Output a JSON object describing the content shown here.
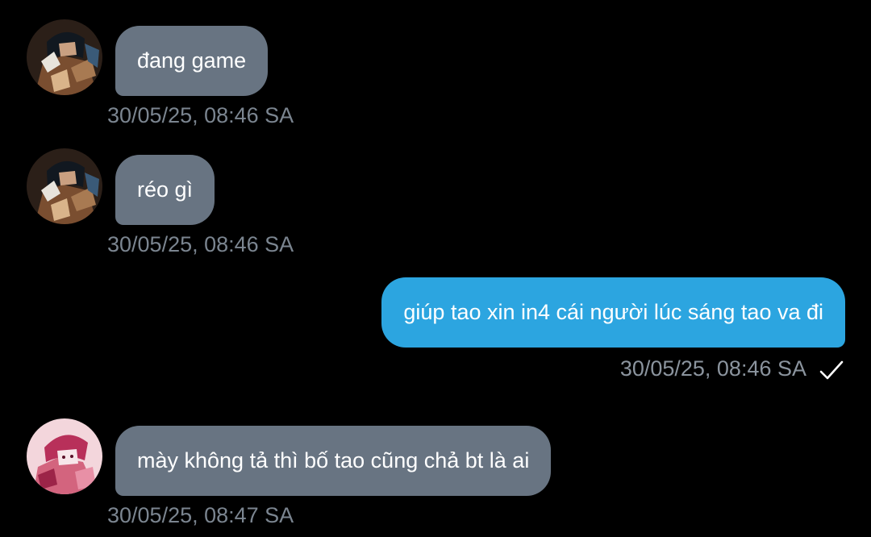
{
  "messages": [
    {
      "direction": "in",
      "avatar": "avatar-anime-dark",
      "text": "đang game",
      "time": "30/05/25, 08:46 SA"
    },
    {
      "direction": "in",
      "avatar": "avatar-anime-dark",
      "text": "réo gì",
      "time": "30/05/25, 08:46 SA"
    },
    {
      "direction": "out",
      "text": "giúp tao xin in4 cái người lúc sáng tao va đi",
      "time": "30/05/25, 08:46 SA",
      "status_icon": "checkmark-icon"
    },
    {
      "direction": "in",
      "avatar": "avatar-anime-pink",
      "text": "mày không tả thì bố tao cũng chả bt là ai",
      "time": "30/05/25, 08:47 SA"
    }
  ],
  "colors": {
    "background": "#000000",
    "incoming_bubble": "#687482",
    "outgoing_bubble": "#2ca5e0",
    "timestamp": "#7b8590"
  }
}
